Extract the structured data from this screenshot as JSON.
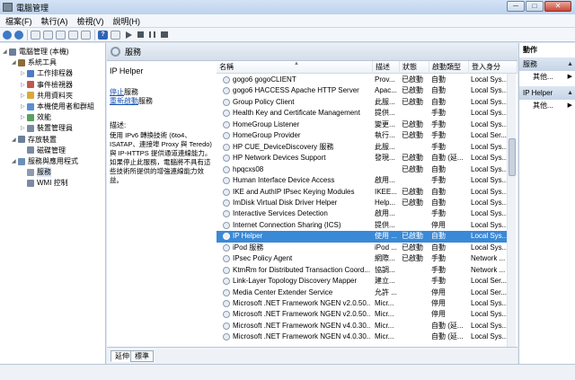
{
  "window": {
    "title": "電腦管理",
    "min_glyph": "─",
    "max_glyph": "□",
    "close_glyph": "✕"
  },
  "menu": [
    "檔案(F)",
    "執行(A)",
    "檢視(V)",
    "說明(H)"
  ],
  "tree": [
    {
      "label": "電腦管理 (本機)",
      "icon": "computer-icon",
      "level": 0
    },
    {
      "label": "系統工具",
      "icon": "tools-icon",
      "level": 1
    },
    {
      "label": "工作排程器",
      "icon": "clock-icon",
      "level": 2
    },
    {
      "label": "事件檢視器",
      "icon": "event-viewer-icon",
      "level": 2
    },
    {
      "label": "共用資料夾",
      "icon": "shared-folder-icon",
      "level": 2
    },
    {
      "label": "本機使用者和群組",
      "icon": "users-icon",
      "level": 2
    },
    {
      "label": "效能",
      "icon": "performance-icon",
      "level": 2
    },
    {
      "label": "裝置管理員",
      "icon": "device-manager-icon",
      "level": 2
    },
    {
      "label": "存放裝置",
      "icon": "storage-icon",
      "level": 1
    },
    {
      "label": "磁碟管理",
      "icon": "disk-icon",
      "level": 2
    },
    {
      "label": "服務與應用程式",
      "icon": "apps-icon",
      "level": 1
    },
    {
      "label": "服務",
      "icon": "services-icon",
      "level": 2,
      "selected": true
    },
    {
      "label": "WMI 控制",
      "icon": "wmi-icon",
      "level": 2
    }
  ],
  "center": {
    "header": "服務",
    "detail": {
      "service_name": "IP Helper",
      "stop_link": "停止",
      "stop_suffix": "服務",
      "restart_link": "重新啟動",
      "restart_suffix": "服務",
      "desc_label": "描述:",
      "description": "使用 IPv6 轉換技術 (6to4、ISATAP、連接埠 Proxy 與 Teredo) 與 IP-HTTPS 提供通道連線能力。如果停止此服務，電腦將不具有這些技術所提供的增強連線能力效益。"
    },
    "columns": [
      "名稱",
      "描述",
      "狀態",
      "啟動類型",
      "登入身分"
    ],
    "rows": [
      {
        "name": "gogo6 gogoCLIENT",
        "desc": "Prov...",
        "status": "已啟動",
        "startup": "自動",
        "logon": "Local Sys..."
      },
      {
        "name": "gogo6 HACCESS Apache HTTP Server",
        "desc": "Apac...",
        "status": "已啟動",
        "startup": "自動",
        "logon": "Local Sys..."
      },
      {
        "name": "Group Policy Client",
        "desc": "此服...",
        "status": "已啟動",
        "startup": "自動",
        "logon": "Local Sys..."
      },
      {
        "name": "Health Key and Certificate Management",
        "desc": "提供...",
        "status": "",
        "startup": "手動",
        "logon": "Local Sys..."
      },
      {
        "name": "HomeGroup Listener",
        "desc": "變更...",
        "status": "已啟動",
        "startup": "手動",
        "logon": "Local Sys..."
      },
      {
        "name": "HomeGroup Provider",
        "desc": "執行...",
        "status": "已啟動",
        "startup": "手動",
        "logon": "Local Ser..."
      },
      {
        "name": "HP CUE_DeviceDiscovery 服務",
        "desc": "此服...",
        "status": "",
        "startup": "手動",
        "logon": "Local Sys..."
      },
      {
        "name": "HP Network Devices Support",
        "desc": "發現...",
        "status": "已啟動",
        "startup": "自動 (延...",
        "logon": "Local Sys..."
      },
      {
        "name": "hpqcxs08",
        "desc": "",
        "status": "已啟動",
        "startup": "自動",
        "logon": "Local Sys..."
      },
      {
        "name": "Human Interface Device Access",
        "desc": "啟用...",
        "status": "",
        "startup": "手動",
        "logon": "Local Sys..."
      },
      {
        "name": "IKE and AuthIP IPsec Keying Modules",
        "desc": "IKEE...",
        "status": "已啟動",
        "startup": "自動",
        "logon": "Local Sys..."
      },
      {
        "name": "ImDisk Virtual Disk Driver Helper",
        "desc": "Help...",
        "status": "已啟動",
        "startup": "自動",
        "logon": "Local Sys..."
      },
      {
        "name": "Interactive Services Detection",
        "desc": "啟用...",
        "status": "",
        "startup": "手動",
        "logon": "Local Sys..."
      },
      {
        "name": "Internet Connection Sharing (ICS)",
        "desc": "提供...",
        "status": "",
        "startup": "停用",
        "logon": "Local Sys..."
      },
      {
        "name": "IP Helper",
        "desc": "使用 ...",
        "status": "已啟動",
        "startup": "自動",
        "logon": "Local Sys...",
        "selected": true
      },
      {
        "name": "iPod 服務",
        "desc": "iPod ...",
        "status": "已啟動",
        "startup": "自動",
        "logon": "Local Sys..."
      },
      {
        "name": "IPsec Policy Agent",
        "desc": "網際...",
        "status": "已啟動",
        "startup": "手動",
        "logon": "Network ..."
      },
      {
        "name": "KtmRm for Distributed Transaction Coord...",
        "desc": "協調...",
        "status": "",
        "startup": "手動",
        "logon": "Network ..."
      },
      {
        "name": "Link-Layer Topology Discovery Mapper",
        "desc": "建立...",
        "status": "",
        "startup": "手動",
        "logon": "Local Ser..."
      },
      {
        "name": "Media Center Extender Service",
        "desc": "允許 ...",
        "status": "",
        "startup": "停用",
        "logon": "Local Ser..."
      },
      {
        "name": "Microsoft .NET Framework NGEN v2.0.50...",
        "desc": "Micr...",
        "status": "",
        "startup": "停用",
        "logon": "Local Sys..."
      },
      {
        "name": "Microsoft .NET Framework NGEN v2.0.50...",
        "desc": "Micr...",
        "status": "",
        "startup": "停用",
        "logon": "Local Sys..."
      },
      {
        "name": "Microsoft .NET Framework NGEN v4.0.30...",
        "desc": "Micr...",
        "status": "",
        "startup": "自動 (延...",
        "logon": "Local Sys..."
      },
      {
        "name": "Microsoft .NET Framework NGEN v4.0.30...",
        "desc": "Micr...",
        "status": "",
        "startup": "自動 (延...",
        "logon": "Local Sys..."
      }
    ],
    "tabs": [
      "延伸",
      "標準"
    ]
  },
  "actions": {
    "title": "動作",
    "sections": [
      {
        "label": "服務",
        "more": "其他..."
      },
      {
        "label": "IP Helper",
        "more": "其他..."
      }
    ]
  }
}
